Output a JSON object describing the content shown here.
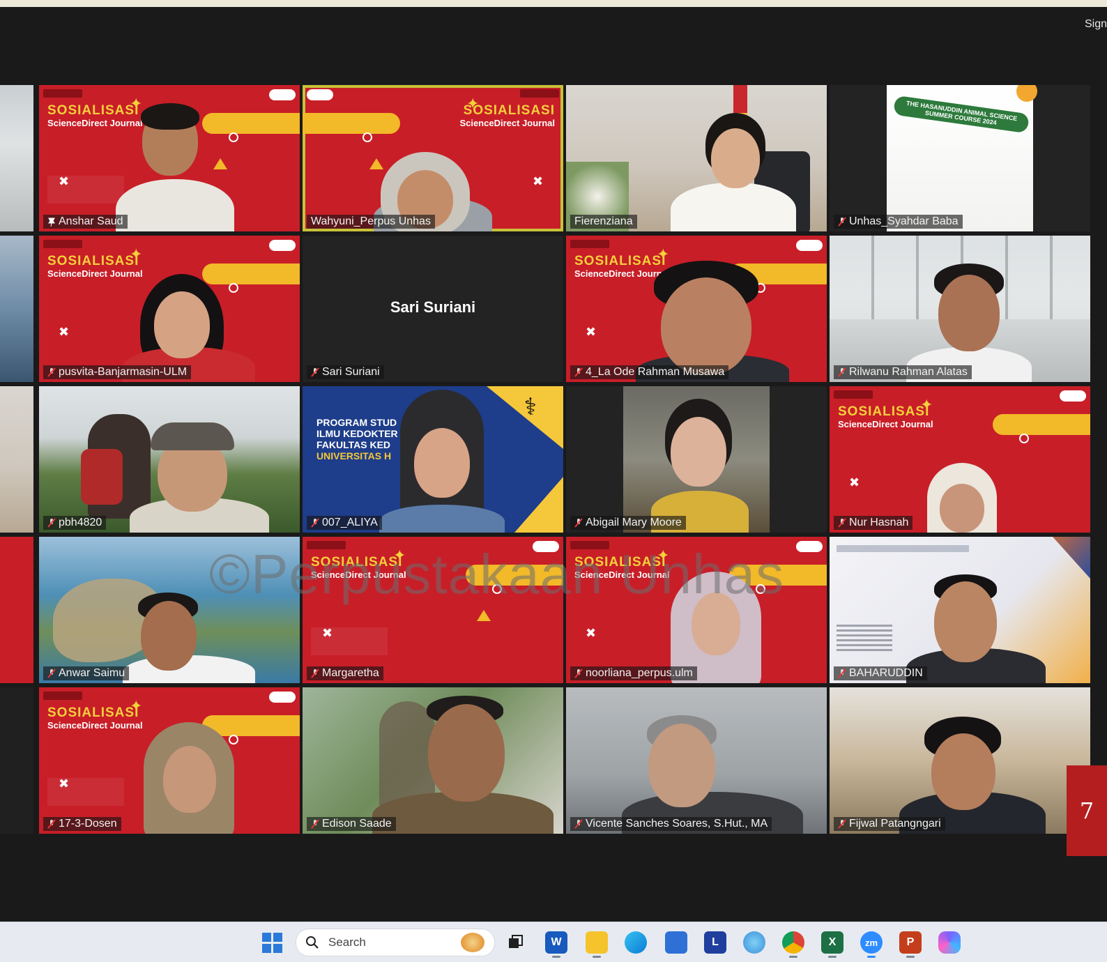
{
  "header": {
    "sign_label": "Sign"
  },
  "participants": [
    {
      "name": "Anshar Saud",
      "slide_title": "SOSIALISASI",
      "slide_sub": "ScienceDirect Journal"
    },
    {
      "name": "Wahyuni_Perpus Unhas",
      "slide_title": "SOSIALISASI",
      "slide_sub": "ScienceDirect Journal"
    },
    {
      "name": "Fierenziana"
    },
    {
      "name": "Unhas_Syahdar Baba",
      "poster_text": "THE HASANUDDIN ANIMAL SCIENCE SUMMER COURSE 2024"
    },
    {
      "name": "pusvita-Banjarmasin-ULM",
      "slide_title": "SOSIALISASI",
      "slide_sub": "ScienceDirect Journal"
    },
    {
      "name": "Sari Suriani",
      "center_name": "Sari Suriani"
    },
    {
      "name": "4_La Ode Rahman Musawa",
      "slide_title": "SOSIALISASI",
      "slide_sub": "ScienceDirect Journal"
    },
    {
      "name": "Rilwanu Rahman Alatas"
    },
    {
      "name": "pbh4820"
    },
    {
      "name": "007_ALIYA",
      "slide_lines": [
        "PROGRAM STUD",
        "ILMU KEDOKTER",
        "FAKULTAS KED",
        "UNIVERSITAS H"
      ]
    },
    {
      "name": "Abigail Mary Moore"
    },
    {
      "name": "Nur Hasnah",
      "slide_title": "SOSIALISASI",
      "slide_sub": "ScienceDirect Journal"
    },
    {
      "name": "Anwar Saimu"
    },
    {
      "name": "Margaretha",
      "slide_title": "SOSIALISASI",
      "slide_sub": "ScienceDirect Journal"
    },
    {
      "name": "noorliana_perpus.ulm",
      "slide_title": "SOSIALISASI",
      "slide_sub": "ScienceDirect Journal"
    },
    {
      "name": "BAHARUDDIN"
    },
    {
      "name": "17-3-Dosen",
      "slide_title": "SOSIALISASI",
      "slide_sub": "ScienceDirect Journal"
    },
    {
      "name": "Edison Saade"
    },
    {
      "name": "Vicente Sanches Soares, S.Hut., MA"
    },
    {
      "name": "Fijwal Patangngari"
    }
  ],
  "watermark": "©Perpustakaan Unhas",
  "page_number": "7",
  "taskbar": {
    "search_placeholder": "Search",
    "apps": [
      "start-icon",
      "search-icon",
      "task-view-icon",
      "word-icon",
      "file-explorer-icon",
      "edge-icon",
      "store-icon",
      "l-app-icon",
      "weather-icon",
      "chrome-icon",
      "excel-icon",
      "zoom-icon",
      "powerpoint-icon",
      "copilot-icon"
    ],
    "app_letters": {
      "word": "W",
      "l_app": "L",
      "excel": "X",
      "zoom": "zm",
      "powerpoint": "P"
    }
  },
  "colors": {
    "slide_red": "#c81e28",
    "slide_yellow": "#f2b928",
    "active_speaker": "#c8c23a",
    "badge": "#b51e1e"
  }
}
